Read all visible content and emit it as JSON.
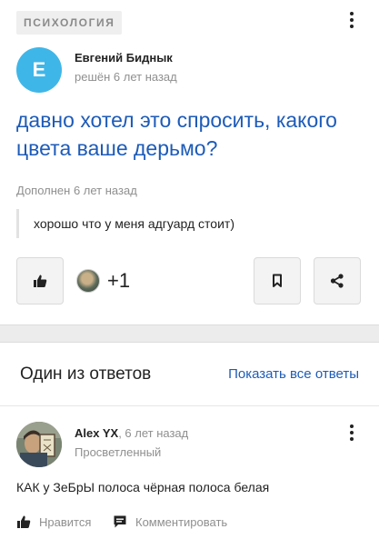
{
  "question": {
    "category": "ПСИХОЛОГИЯ",
    "avatar_letter": "E",
    "author_name": "Евгений Биднык",
    "author_meta": "решён 6 лет назад",
    "title": "давно хотел это спросить, какого цвета ваше дерьмо?",
    "added_note": "Дополнен 6 лет назад",
    "addition_text": "хорошо что у меня адгуард стоит)",
    "likes_extra": "+1"
  },
  "answers": {
    "heading": "Один из ответов",
    "show_all_label": "Показать все ответы",
    "item": {
      "author_name": "Alex YX",
      "time": ", 6 лет назад",
      "rank": "Просветленный",
      "text": "КАК у ЗеБрЫ полоса чёрная полоса белая",
      "like_label": "Нравится",
      "comment_label": "Комментировать"
    }
  },
  "colors": {
    "accent_link": "#1d5bb8",
    "avatar_bg": "#3fb6e8"
  }
}
